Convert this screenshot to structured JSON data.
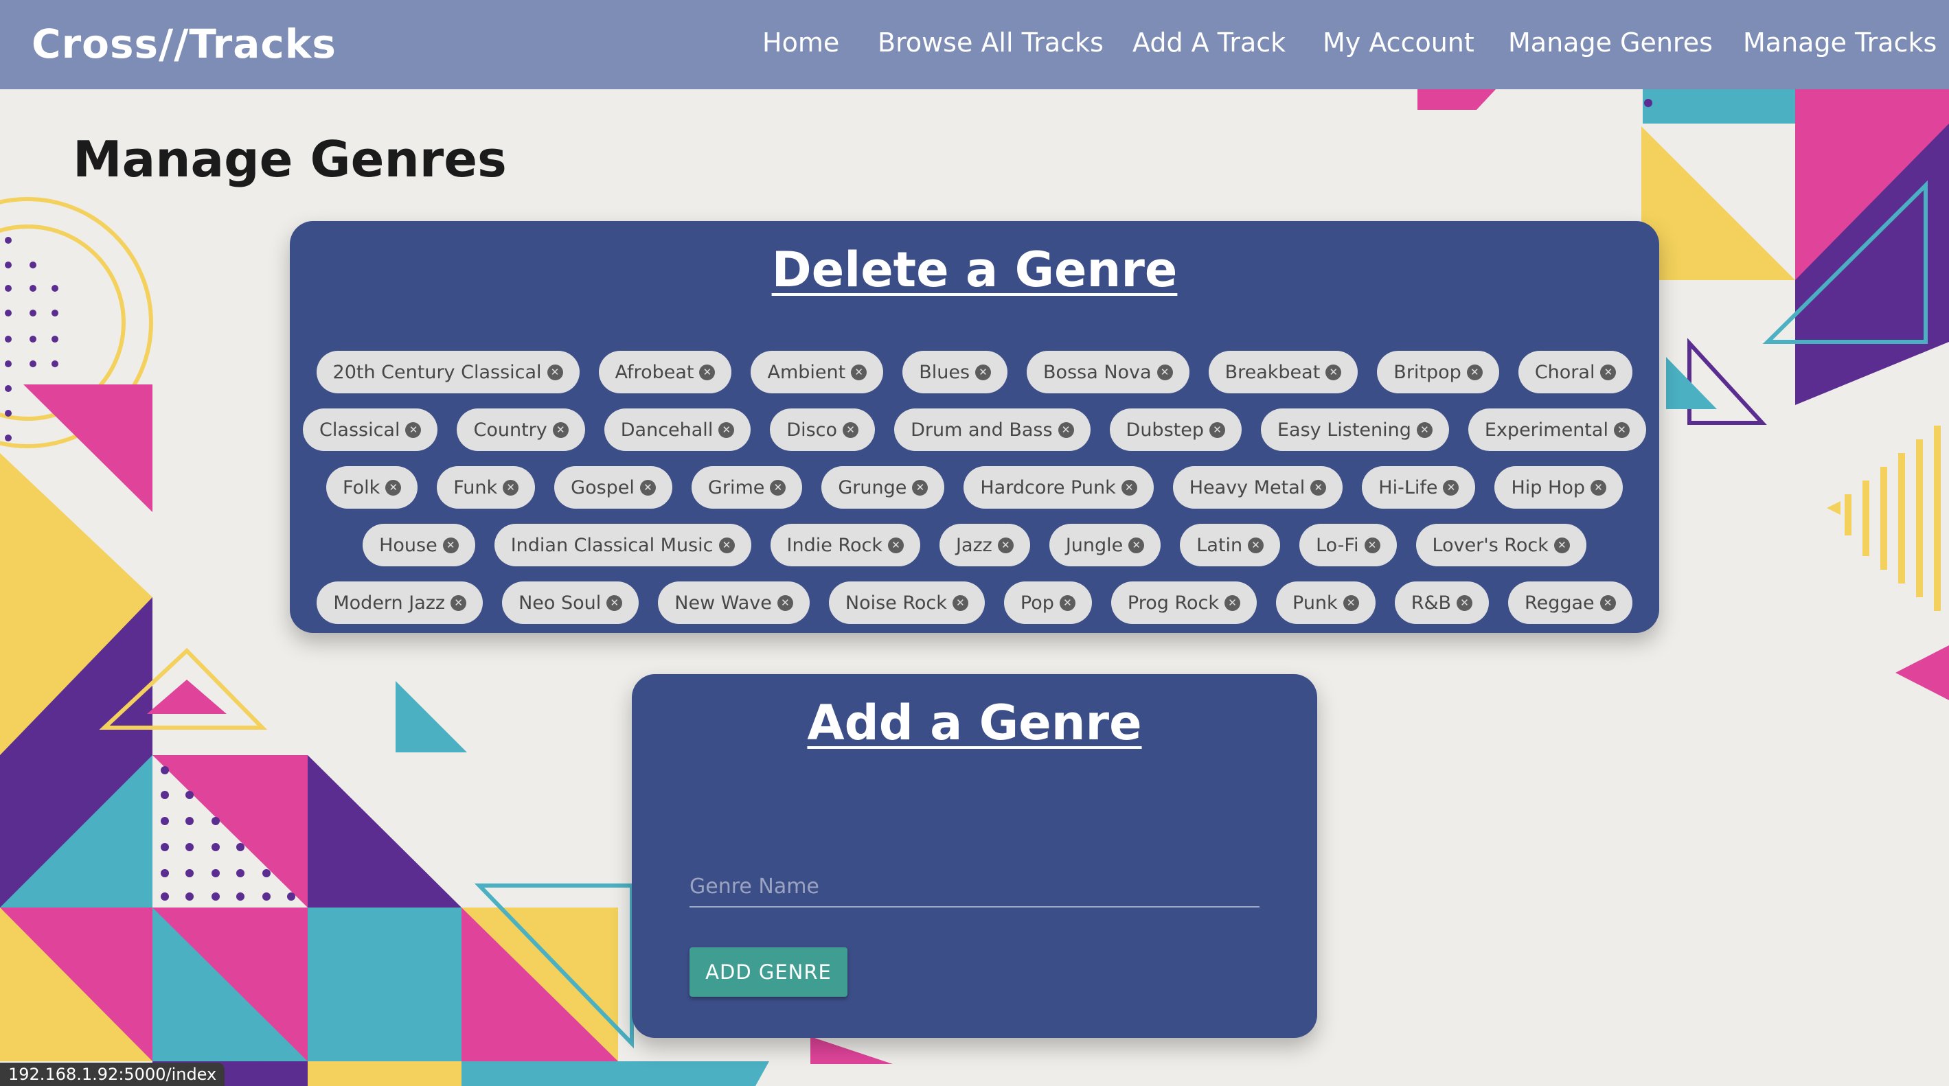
{
  "brand": "Cross//Tracks",
  "nav": {
    "home": "Home",
    "browse": "Browse All Tracks",
    "add_track": "Add A Track",
    "account": "My Account",
    "manage_genres": "Manage Genres",
    "manage_tracks": "Manage Tracks"
  },
  "page_title": "Manage Genres",
  "delete_section": {
    "title": "Delete a Genre",
    "remove_icon": "close-circle-icon",
    "genres": [
      [
        "20th Century Classical",
        "Afrobeat",
        "Ambient",
        "Blues",
        "Bossa Nova",
        "Breakbeat",
        "Britpop",
        "Choral"
      ],
      [
        "Classical",
        "Country",
        "Dancehall",
        "Disco",
        "Drum and Bass",
        "Dubstep",
        "Easy Listening",
        "Experimental"
      ],
      [
        "Folk",
        "Funk",
        "Gospel",
        "Grime",
        "Grunge",
        "Hardcore Punk",
        "Heavy Metal",
        "Hi-Life",
        "Hip Hop"
      ],
      [
        "House",
        "Indian Classical Music",
        "Indie Rock",
        "Jazz",
        "Jungle",
        "Latin",
        "Lo-Fi",
        "Lover's Rock"
      ],
      [
        "Modern Jazz",
        "Neo Soul",
        "New Wave",
        "Noise Rock",
        "Pop",
        "Prog Rock",
        "Punk",
        "R&B",
        "Reggae"
      ]
    ]
  },
  "add_section": {
    "title": "Add a Genre",
    "input_placeholder": "Genre Name",
    "input_value": "",
    "button_label": "ADD GENRE"
  },
  "status_bar_url": "192.168.1.92:5000/index",
  "colors": {
    "navbar": "#7e8db5",
    "card": "#3c4e88",
    "chip": "#e0e0e0",
    "button": "#3f9e91",
    "background": "#eeede9",
    "accent_pink": "#e0449a",
    "accent_yellow": "#f3d15c",
    "accent_purple": "#5b2d91",
    "accent_teal": "#4ab0c2"
  }
}
